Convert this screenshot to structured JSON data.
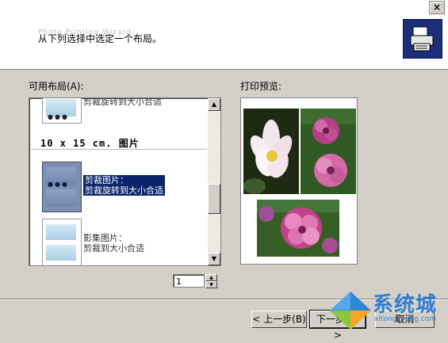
{
  "header": {
    "ghost_text": "Photo Printing Wizard",
    "instruction": "从下列选择中选定一个布局。",
    "close_glyph": "×"
  },
  "layouts": {
    "label": "可用布局(A):",
    "items": [
      {
        "text": "剪裁旋转到大小合适"
      },
      {
        "text": "剪裁图片：\n剪裁旋转到大小合适",
        "selected": true
      },
      {
        "text": "影集图片：\n剪裁到大小合适"
      }
    ],
    "group_header": "10 x 15 cm. 图片"
  },
  "preview": {
    "label": "打印预览:"
  },
  "spinner": {
    "value": "1"
  },
  "buttons": {
    "back": "< 上一步(B)",
    "next": "下一步(N) >",
    "cancel": "取消"
  },
  "watermark": {
    "text": "系统城",
    "url": "xitongcheng.com"
  },
  "colors": {
    "selection": "#0a246a",
    "dialog_bg": "#d4d0c8",
    "icon_bg": "#1c2d7a"
  }
}
